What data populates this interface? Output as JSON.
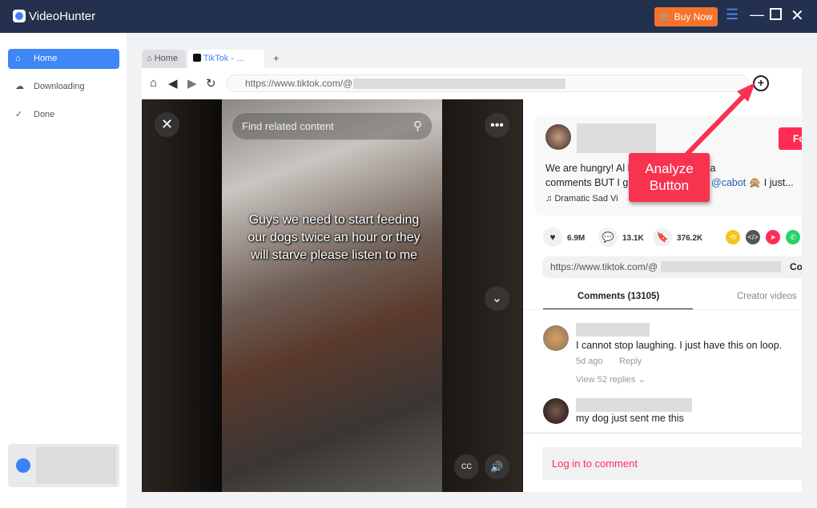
{
  "app": {
    "title": "VideoHunter",
    "buy_label": "Buy Now"
  },
  "sidebar": {
    "items": [
      {
        "label": "Home",
        "active": true
      },
      {
        "label": "Downloading"
      },
      {
        "label": "Done"
      }
    ]
  },
  "browser": {
    "tabs": [
      {
        "label": "Home"
      },
      {
        "label": "TikTok - ..."
      }
    ],
    "new_tab": "+",
    "url": "https://www.tiktok.com/@"
  },
  "video": {
    "search_placeholder": "Find related content",
    "caption": "Guys we need to start feeding our dogs twice an hour or they will starve please listen to me"
  },
  "post": {
    "follow_label": "Fo",
    "description_line1": "We are hungry! Al                        he caption as well a",
    "description_line2_a": "comments BUT I g",
    "mention": "@cabot",
    "description_line2_b": "🙊 I just...",
    "music": "Dramatic Sad Vi",
    "likes": "6.9M",
    "comments": "13.1K",
    "saves": "376.2K",
    "link": "https://www.tiktok.com/@",
    "copy_label": "Co"
  },
  "comment_tabs": [
    {
      "label": "Comments (13105)",
      "active": true
    },
    {
      "label": "Creator videos"
    }
  ],
  "comments": [
    {
      "text": "I cannot stop laughing. I just have this on loop.",
      "time": "5d ago",
      "reply": "Reply",
      "view_replies": "View 52 replies"
    },
    {
      "text": "my dog just sent me this"
    }
  ],
  "login_label": "Log in to comment",
  "annotation": {
    "text": "Analyze Button",
    "color": "#f7334f"
  },
  "colors": {
    "accent": "#3f86f7",
    "tiktok": "#fe2c55",
    "titlebar": "#23314f",
    "buy": "#f5732a"
  }
}
